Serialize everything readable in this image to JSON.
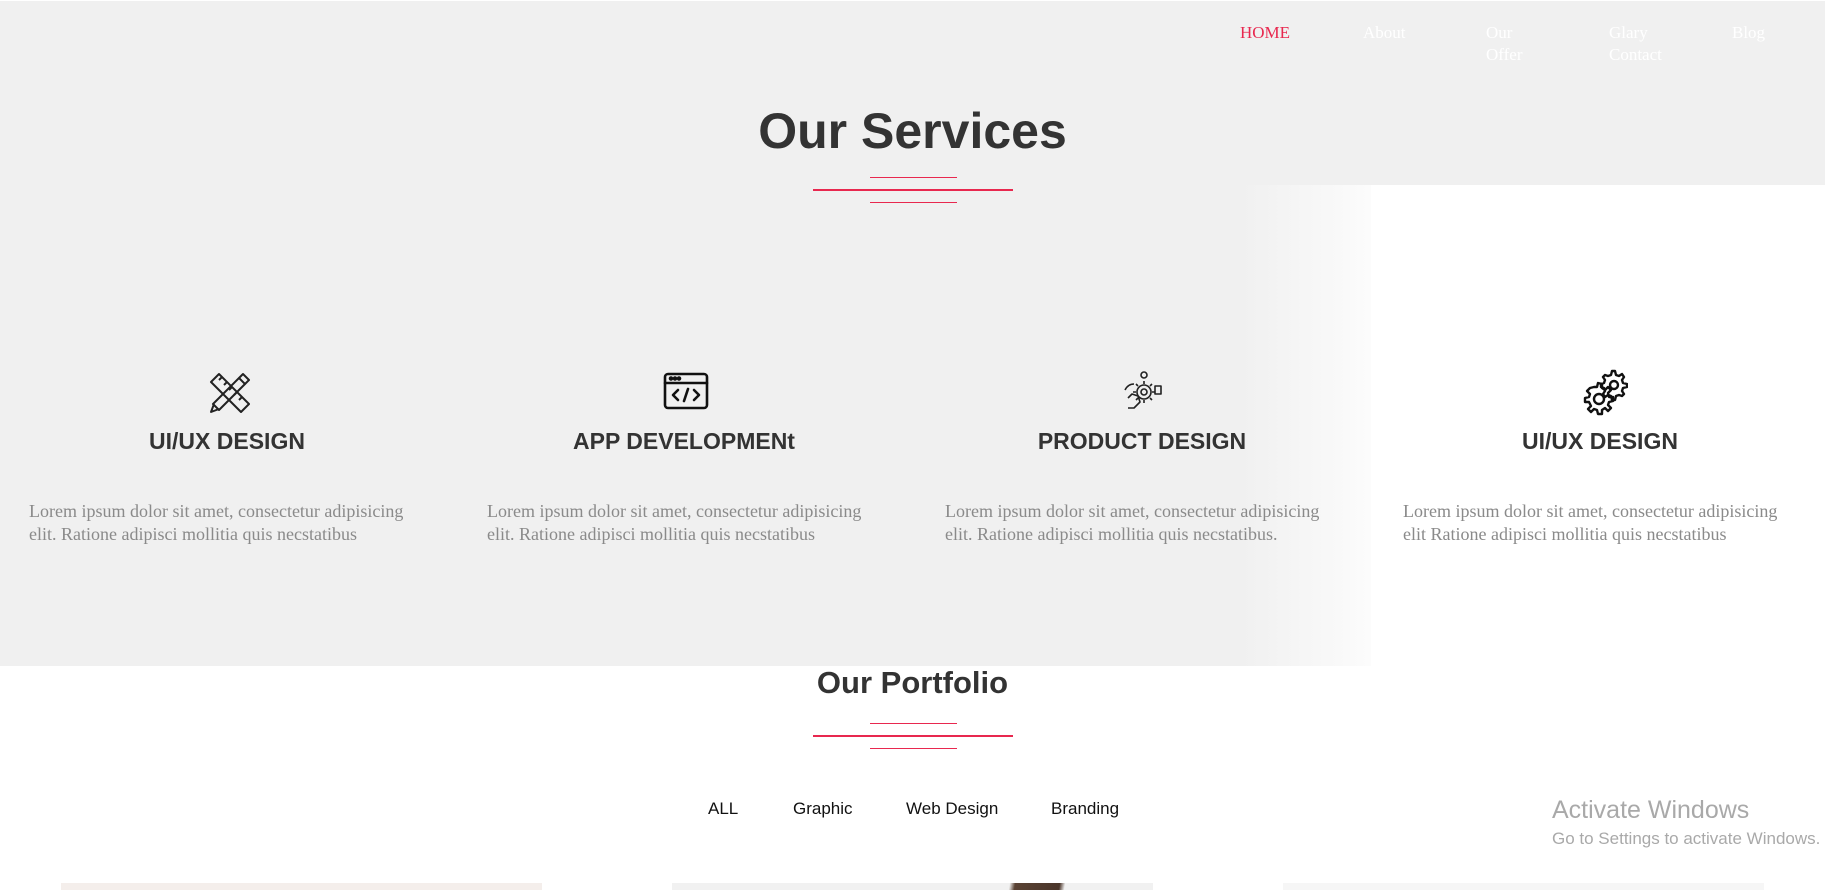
{
  "nav": {
    "items": [
      {
        "label": "HOME",
        "active": true
      },
      {
        "label": "About"
      },
      {
        "label": "Our Offer"
      },
      {
        "label": "Glary Contact"
      },
      {
        "label": "Blog"
      }
    ]
  },
  "services": {
    "title": "Our Services",
    "cards": [
      {
        "icon": "pencil-ruler-icon",
        "heading": "UI/UX DESIGN",
        "text": "Lorem ipsum dolor sit amet, consectetur adipisicing elit. Ratione adipisci mollitia quis necstatibus"
      },
      {
        "icon": "code-window-icon",
        "heading": "APP DEVELOPMENt",
        "text": "Lorem ipsum dolor sit amet, consectetur adipisicing elit. Ratione adipisci mollitia quis necstatibus"
      },
      {
        "icon": "hand-gear-icon",
        "heading": "PRODUCT DESIGN",
        "text": "Lorem ipsum dolor sit amet, consectetur adipisicing elit. Ratione adipisci mollitia quis necstatibus."
      },
      {
        "icon": "gears-icon",
        "heading": "UI/UX DESIGN",
        "text": "Lorem ipsum dolor sit amet, consectetur adipisicing elit Ratione adipisci mollitia quis necstatibus"
      }
    ]
  },
  "portfolio": {
    "title": "Our Portfolio",
    "filters": [
      "ALL",
      "Graphic",
      "Web Design",
      "Branding"
    ]
  },
  "watermark": {
    "line1": "Activate Windows",
    "line2": "Go to Settings to activate Windows."
  },
  "colors": {
    "accent": "#e8284f",
    "heading": "#333333",
    "body_text": "#8a8a8a",
    "section_bg": "#f0f0f0"
  }
}
